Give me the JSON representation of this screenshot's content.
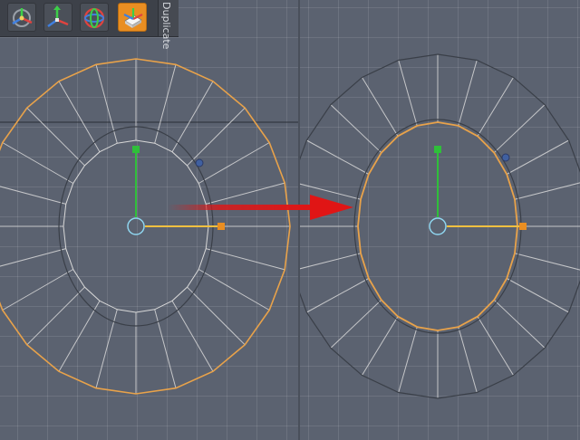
{
  "toolbar": {
    "tools": [
      {
        "icon": "transform-gizmo-icon",
        "active": false
      },
      {
        "icon": "move-axes-icon",
        "active": false
      },
      {
        "icon": "rotate-sphere-icon",
        "active": false
      },
      {
        "icon": "element-move-icon",
        "active": true
      }
    ],
    "side_tab_label": "Duplicate"
  },
  "colors": {
    "background": "#5b6270",
    "grid": "rgba(255,255,255,0.10)",
    "mesh_edge": "#d8d8d8",
    "selected_edge": "#e8a24a",
    "outline": "#3a3f48",
    "y_axis": "#2fbf3a",
    "x_axis": "#f2c040",
    "arrow": "#e01515",
    "accent": "#e98e22"
  },
  "annotation": {
    "type": "red-arrow",
    "meaning": "before-to-after"
  }
}
